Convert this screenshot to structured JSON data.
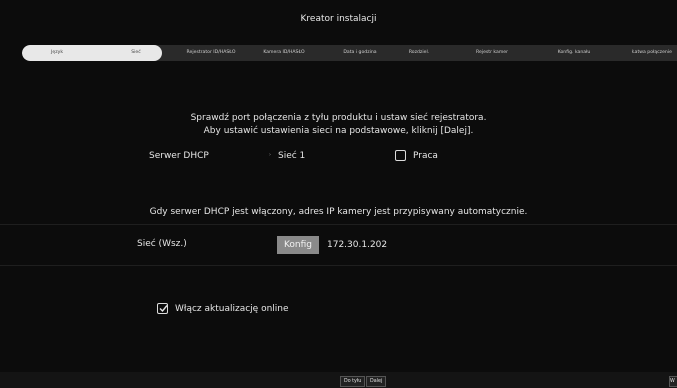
{
  "window": {
    "title": "Kreator instalacji"
  },
  "steps": [
    {
      "label": "Język"
    },
    {
      "label": "Sieć"
    },
    {
      "label": "Rejestrator ID/HASŁO"
    },
    {
      "label": "Kamera ID/HASŁO"
    },
    {
      "label": "Data i godzina"
    },
    {
      "label": "Rozdziel."
    },
    {
      "label": "Rejestr kamer"
    },
    {
      "label": "Konfig. kanału"
    },
    {
      "label": "Łatwa połączenie"
    }
  ],
  "main": {
    "instruction_line1": "Sprawdź port połączenia z tyłu produktu i ustaw sieć rejestratora.",
    "instruction_line2": "Aby ustawić ustawienia sieci na podstawowe, kliknij [Dalej].",
    "dhcp_label": "Serwer DHCP",
    "dhcp_network": "Sieć 1",
    "praca_label": "Praca",
    "praca_checked": false,
    "dhcp_note": "Gdy serwer DHCP jest włączony, adres IP kamery jest przypisywany automatycznie.",
    "network_label": "Sieć (Wsz.)",
    "konfig_button": "Konfig",
    "ip_address": "172.30.1.202",
    "online_update_label": "Włącz aktualizację online",
    "online_update_checked": true
  },
  "footer": {
    "back_button": "Do tyłu",
    "next_button": "Dalej",
    "corner_button": "W"
  },
  "colors": {
    "background": "#0c0c0c",
    "active_step": "#e8e8e8",
    "konfig_button": "#8a8a8a"
  }
}
